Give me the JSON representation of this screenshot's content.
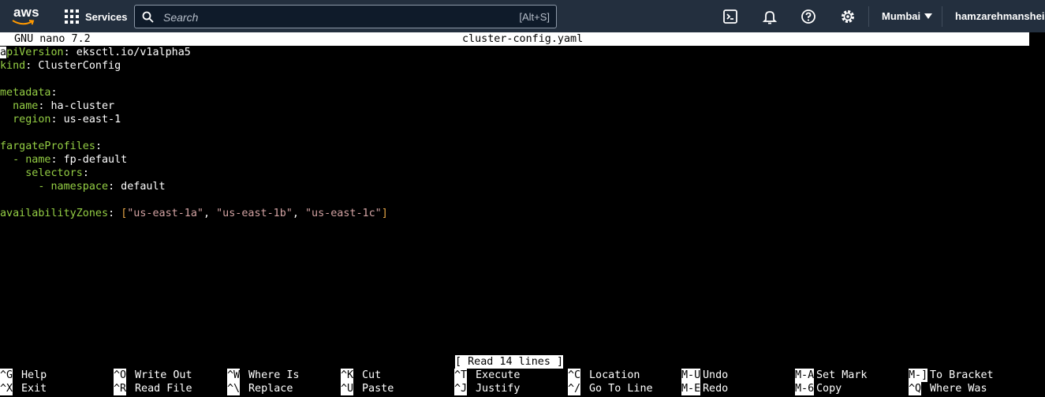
{
  "aws": {
    "logo_text": "aws",
    "services_label": "Services",
    "search_placeholder": "Search",
    "search_shortcut": "[Alt+S]",
    "region": "Mumbai",
    "user": "hamzarehmansheikh",
    "icons": [
      "cloudshell-icon",
      "notifications-bell-icon",
      "help-icon",
      "settings-gear-icon"
    ]
  },
  "nano": {
    "version": "GNU nano 7.2",
    "filename": "cluster-config.yaml",
    "status": "[ Read 14 lines ]",
    "file_lines": [
      [
        [
          "k",
          "apiVersion"
        ],
        [
          "t",
          ": eksctl.io/v1alpha5"
        ]
      ],
      [
        [
          "k",
          "kind"
        ],
        [
          "t",
          ": ClusterConfig"
        ]
      ],
      [],
      [
        [
          "k",
          "metadata"
        ],
        [
          "t",
          ":"
        ]
      ],
      [
        [
          "t",
          "  "
        ],
        [
          "k",
          "name"
        ],
        [
          "t",
          ": ha-cluster"
        ]
      ],
      [
        [
          "t",
          "  "
        ],
        [
          "k",
          "region"
        ],
        [
          "t",
          ": us-east-1"
        ]
      ],
      [],
      [
        [
          "k",
          "fargateProfiles"
        ],
        [
          "t",
          ":"
        ]
      ],
      [
        [
          "t",
          "  "
        ],
        [
          "k",
          "- name"
        ],
        [
          "t",
          ": fp-default"
        ]
      ],
      [
        [
          "t",
          "    "
        ],
        [
          "k",
          "selectors"
        ],
        [
          "t",
          ":"
        ]
      ],
      [
        [
          "t",
          "      "
        ],
        [
          "k",
          "- namespace"
        ],
        [
          "t",
          ": default"
        ]
      ],
      [],
      [
        [
          "k",
          "availabilityZones"
        ],
        [
          "t",
          ": "
        ],
        [
          "b",
          "["
        ],
        [
          "s",
          "\"us-east-1a\""
        ],
        [
          "t",
          ", "
        ],
        [
          "s",
          "\"us-east-1b\""
        ],
        [
          "t",
          ", "
        ],
        [
          "s",
          "\"us-east-1c\""
        ],
        [
          "b",
          "]"
        ]
      ]
    ],
    "shortcuts_row1": [
      {
        "key": "^G",
        "label": "Help"
      },
      {
        "key": "^O",
        "label": "Write Out"
      },
      {
        "key": "^W",
        "label": "Where Is"
      },
      {
        "key": "^K",
        "label": "Cut"
      },
      {
        "key": "^T",
        "label": "Execute"
      },
      {
        "key": "^C",
        "label": "Location"
      },
      {
        "key": "M-U",
        "label": "Undo"
      },
      {
        "key": "M-A",
        "label": "Set Mark"
      },
      {
        "key": "M-]",
        "label": "To Bracket"
      }
    ],
    "shortcuts_row2": [
      {
        "key": "^X",
        "label": "Exit"
      },
      {
        "key": "^R",
        "label": "Read File"
      },
      {
        "key": "^\\",
        "label": "Replace"
      },
      {
        "key": "^U",
        "label": "Paste"
      },
      {
        "key": "^J",
        "label": "Justify"
      },
      {
        "key": "^/",
        "label": "Go To Line"
      },
      {
        "key": "M-E",
        "label": "Redo"
      },
      {
        "key": "M-6",
        "label": "Copy"
      },
      {
        "key": "^Q",
        "label": "Where Was"
      }
    ]
  }
}
